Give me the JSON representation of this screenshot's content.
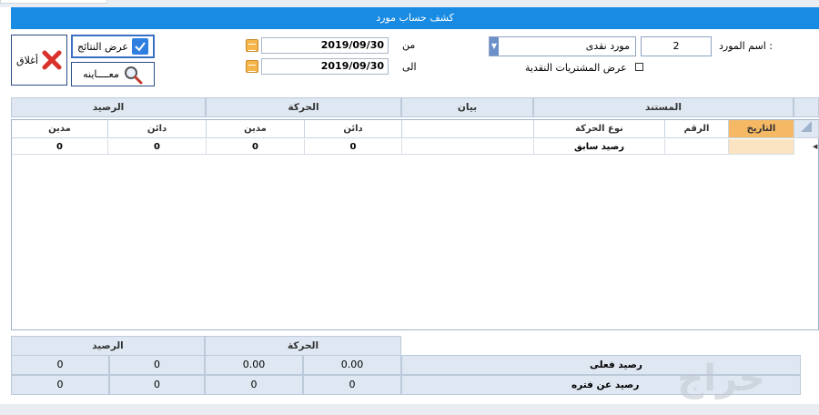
{
  "window": {
    "title": "كشف حساب مورد"
  },
  "toolbar": {
    "close_label": "أغلاق",
    "results_label": "عرض النتائج",
    "preview_label": "معــــاينه"
  },
  "filters": {
    "from_label": "من",
    "to_label": "الى",
    "from_date": "2019/09/30",
    "to_date": "2019/09/30",
    "supplier_label": "اسم المورد :",
    "supplier_code": "2",
    "supplier_name": "مورد نقدى",
    "cash_purchases_label": "عرض المشتريات النقدية",
    "cash_purchases_checked": false
  },
  "grid": {
    "groups": {
      "document": "المستند",
      "statement": "بيان",
      "movement": "الحركة",
      "balance": "الرصيد"
    },
    "columns": {
      "date": "التاريخ",
      "number": "الرقم",
      "movement_type": "نوع الحركة",
      "statement": "",
      "credit_move": "دائن",
      "debit_move": "مدين",
      "credit_bal": "دائن",
      "debit_bal": "مدين"
    },
    "rows": [
      {
        "date": "",
        "number": "",
        "movement_type": "رصيد سابق",
        "statement": "",
        "credit_move": "0",
        "debit_move": "0",
        "credit_bal": "0",
        "debit_bal": "0"
      }
    ]
  },
  "totals": {
    "movement_label": "الحركة",
    "balance_label": "الرصيد",
    "actual_balance": {
      "label": "رصيد فعلى",
      "values": [
        "0.00",
        "0.00",
        "0",
        "0"
      ]
    },
    "period_balance": {
      "label": "رصيد عن فتره",
      "values": [
        "0",
        "0",
        "0",
        "0"
      ]
    }
  },
  "watermark": "حراج",
  "colors": {
    "titlebar": "#1a8be3",
    "accent_orange": "#f5b865",
    "header_bg": "#dfe8f2"
  }
}
